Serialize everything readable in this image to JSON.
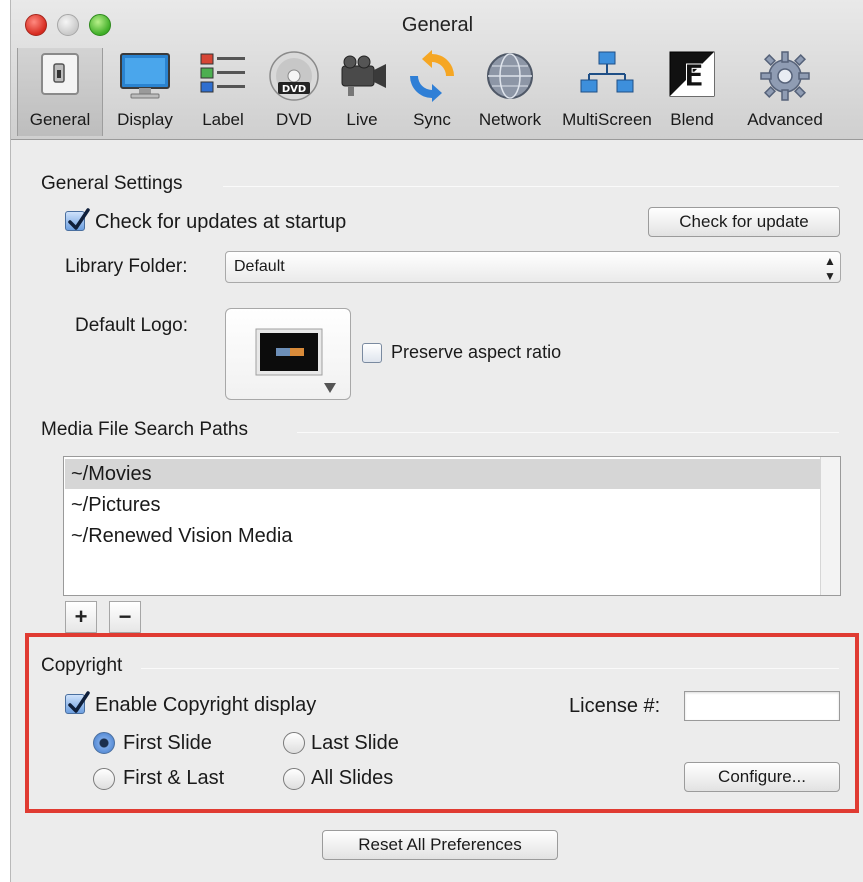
{
  "window": {
    "title": "General"
  },
  "toolbar": {
    "items": [
      {
        "label": "General",
        "icon": "general-switch-icon",
        "active": true
      },
      {
        "label": "Display",
        "icon": "display-monitor-icon"
      },
      {
        "label": "Label",
        "icon": "label-list-icon"
      },
      {
        "label": "DVD",
        "icon": "dvd-disc-icon",
        "disc_text": "DVD"
      },
      {
        "label": "Live",
        "icon": "video-camera-icon"
      },
      {
        "label": "Sync",
        "icon": "sync-arrows-icon"
      },
      {
        "label": "Network",
        "icon": "network-globe-icon"
      },
      {
        "label": "MultiScreen",
        "icon": "multiscreen-icon"
      },
      {
        "label": "Blend",
        "icon": "blend-icon",
        "glyph": "E"
      },
      {
        "label": "Advanced",
        "icon": "gear-icon"
      }
    ]
  },
  "general_settings": {
    "title": "General Settings",
    "check_updates_label": "Check for updates at startup",
    "check_updates_checked": true,
    "check_update_button": "Check for update",
    "library_folder_label": "Library Folder:",
    "library_folder_value": "Default",
    "default_logo_label": "Default Logo:",
    "preserve_aspect_label": "Preserve aspect ratio",
    "preserve_aspect_checked": false
  },
  "media_paths": {
    "title": "Media File Search Paths",
    "items": [
      "~/Movies",
      "~/Pictures",
      "~/Renewed Vision Media"
    ],
    "selected_index": 0,
    "add_label": "+",
    "remove_label": "−"
  },
  "copyright": {
    "title": "Copyright",
    "enable_label": "Enable Copyright display",
    "enable_checked": true,
    "license_label": "License #:",
    "license_value": "",
    "options": [
      "First Slide",
      "Last Slide",
      "First & Last",
      "All Slides"
    ],
    "selected_option": "First Slide",
    "configure_button": "Configure..."
  },
  "footer": {
    "reset_button": "Reset All Preferences"
  },
  "colors": {
    "highlight_border": "#e03b32",
    "checkbox_accent": "#6d9fe0"
  }
}
